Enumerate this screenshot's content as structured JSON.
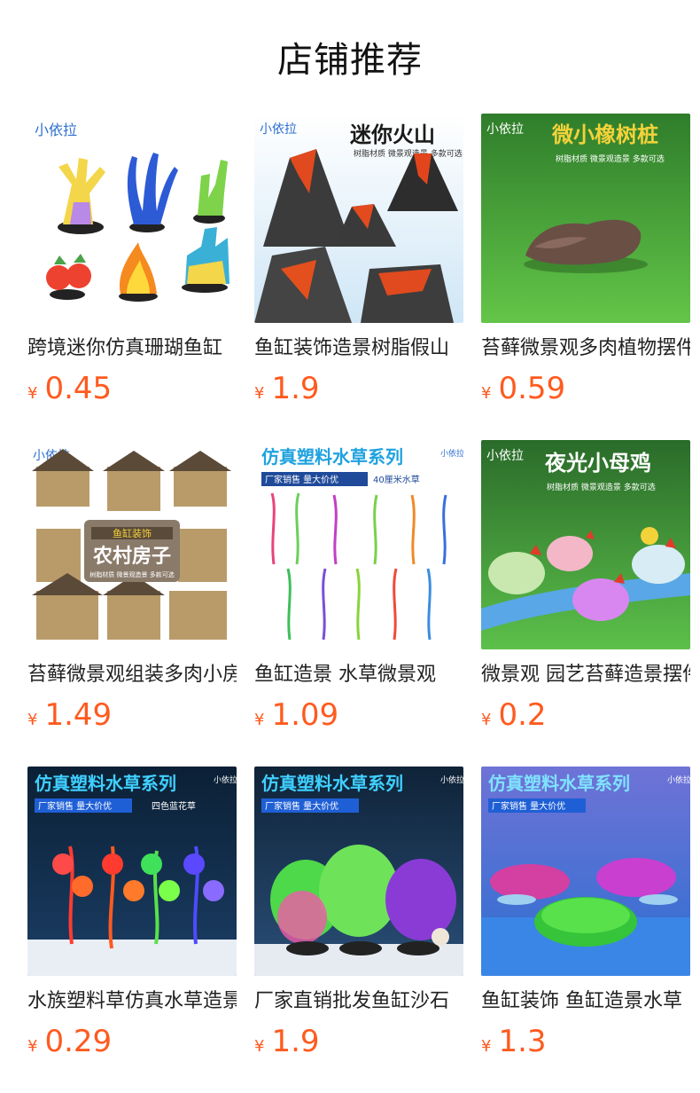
{
  "header": {
    "title": "店铺推荐"
  },
  "currency_symbol": "¥",
  "products": [
    {
      "title": "跨境迷你仿真珊瑚鱼缸",
      "price": "0.45",
      "image": {
        "brand": "小依拉",
        "theme": "coral"
      }
    },
    {
      "title": "鱼缸装饰造景树脂假山",
      "price": "1.9",
      "image": {
        "brand": "小依拉",
        "headline": "迷你火山",
        "sub": "树脂材质 微景观造景 多款可选",
        "theme": "volcano"
      }
    },
    {
      "title": "苔藓微景观多肉植物摆件",
      "price": "0.59",
      "image": {
        "brand": "小依拉",
        "headline": "微小橡树桩",
        "sub": "树脂材质 微景观造景 多款可选",
        "theme": "stump"
      }
    },
    {
      "title": "苔藓微景观组装多肉小房子",
      "price": "1.49",
      "image": {
        "brand": "小依拉",
        "headline": "鱼缸装饰",
        "headline2": "农村房子",
        "sub": "树脂材质 微景观造景 多款可选",
        "theme": "houses"
      }
    },
    {
      "title": "鱼缸造景 水草微景观",
      "price": "1.09",
      "image": {
        "brand": "小依拉",
        "headline": "仿真塑料水草系列",
        "sub": "厂家销售 量大价优",
        "sub2": "40厘米水草",
        "theme": "plants"
      }
    },
    {
      "title": "微景观 园艺苔藓造景摆件",
      "price": "0.2",
      "image": {
        "brand": "小依拉",
        "headline": "夜光小母鸡",
        "sub": "树脂材质 微景观造景 多款可选",
        "theme": "hens"
      }
    },
    {
      "title": "水族塑料草仿真水草造景",
      "price": "0.29",
      "image": {
        "brand": "小依拉",
        "headline": "仿真塑料水草系列",
        "sub": "厂家销售 量大价优",
        "sub2": "四色蓝花草",
        "theme": "plants-dark"
      }
    },
    {
      "title": "厂家直销批发鱼缸沙石",
      "price": "1.9",
      "image": {
        "brand": "小依拉",
        "headline": "仿真塑料水草系列",
        "sub": "厂家销售 量大价优",
        "theme": "plants-green"
      }
    },
    {
      "title": "鱼缸装饰 鱼缸造景水草",
      "price": "1.3",
      "image": {
        "brand": "小依拉",
        "headline": "仿真塑料水草系列",
        "sub": "厂家销售 量大价优",
        "theme": "moss-balls"
      }
    }
  ],
  "colors": {
    "price": "#ff5a1f",
    "title_text": "#222222"
  }
}
